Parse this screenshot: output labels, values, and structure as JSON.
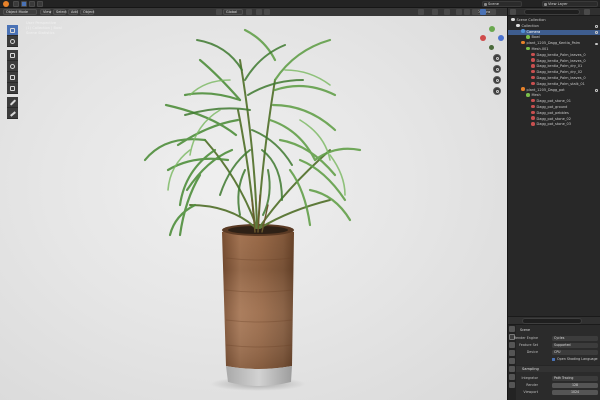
{
  "topbar": {
    "scene": "Scene",
    "view_layer": "View Layer",
    "options": "Options"
  },
  "viewport": {
    "mode": "Object Mode",
    "menus": [
      "View",
      "Select",
      "Add",
      "Object"
    ],
    "orientation": "Global",
    "overlay_lines": [
      "User Perspective",
      "(1) Collection | Bowl",
      "Scene Statistics"
    ]
  },
  "outliner": {
    "rows": [
      {
        "label": "Scene Collection",
        "indent": 0,
        "color": "#dddddd"
      },
      {
        "label": "Collection",
        "indent": 1,
        "color": "#dddddd"
      },
      {
        "label": "Camera",
        "indent": 2,
        "color": "#4f8fd6",
        "selected": true
      },
      {
        "label": "Bowl",
        "indent": 3,
        "color": "#7bbf4a"
      },
      {
        "label": "plant_1205_Dagg_Kentia_Palm",
        "indent": 2,
        "color": "#e8822a"
      },
      {
        "label": "Mesh.001",
        "indent": 3,
        "color": "#7bbf4a"
      },
      {
        "label": "Dagg_kentia_Palm_leaves_0",
        "indent": 4,
        "color": "#c85050"
      },
      {
        "label": "Dagg_kentia_Palm_leaves_0",
        "indent": 4,
        "color": "#c85050"
      },
      {
        "label": "Dagg_kentia_Palm_dry_01",
        "indent": 4,
        "color": "#c85050"
      },
      {
        "label": "Dagg_kentia_Palm_dry_02",
        "indent": 4,
        "color": "#c85050"
      },
      {
        "label": "Dagg_kentia_Palm_leaves_0",
        "indent": 4,
        "color": "#c85050"
      },
      {
        "label": "Dagg_kentia_Palm_stalk_01",
        "indent": 4,
        "color": "#c85050"
      },
      {
        "label": "plant_1205_Dagg_pot",
        "indent": 2,
        "color": "#e8822a"
      },
      {
        "label": "Mesh",
        "indent": 3,
        "color": "#7bbf4a"
      },
      {
        "label": "Dagg_pot_stone_01",
        "indent": 4,
        "color": "#c85050"
      },
      {
        "label": "Dagg_pot_ground",
        "indent": 4,
        "color": "#c85050"
      },
      {
        "label": "Dagg_pot_pebbles",
        "indent": 4,
        "color": "#c85050"
      },
      {
        "label": "Dagg_pot_stone_02",
        "indent": 4,
        "color": "#c85050"
      },
      {
        "label": "Dagg_pot_stone_03",
        "indent": 4,
        "color": "#c85050"
      }
    ]
  },
  "properties": {
    "title": "Scene",
    "render_engine_label": "Render Engine",
    "render_engine": "Cycles",
    "feature_set_label": "Feature Set",
    "feature_set": "Supported",
    "device_label": "Device",
    "device": "CPU",
    "osl_label": "Open Shading Language",
    "sampling_section": "Sampling",
    "integrator_label": "Integrator",
    "integrator": "Path Tracing",
    "render_label": "Render",
    "render_samples": "128",
    "viewport_label": "Viewport",
    "viewport_samples": "1024"
  },
  "colors": {
    "accent": "#4a72b5",
    "brand": "#e8822a"
  }
}
